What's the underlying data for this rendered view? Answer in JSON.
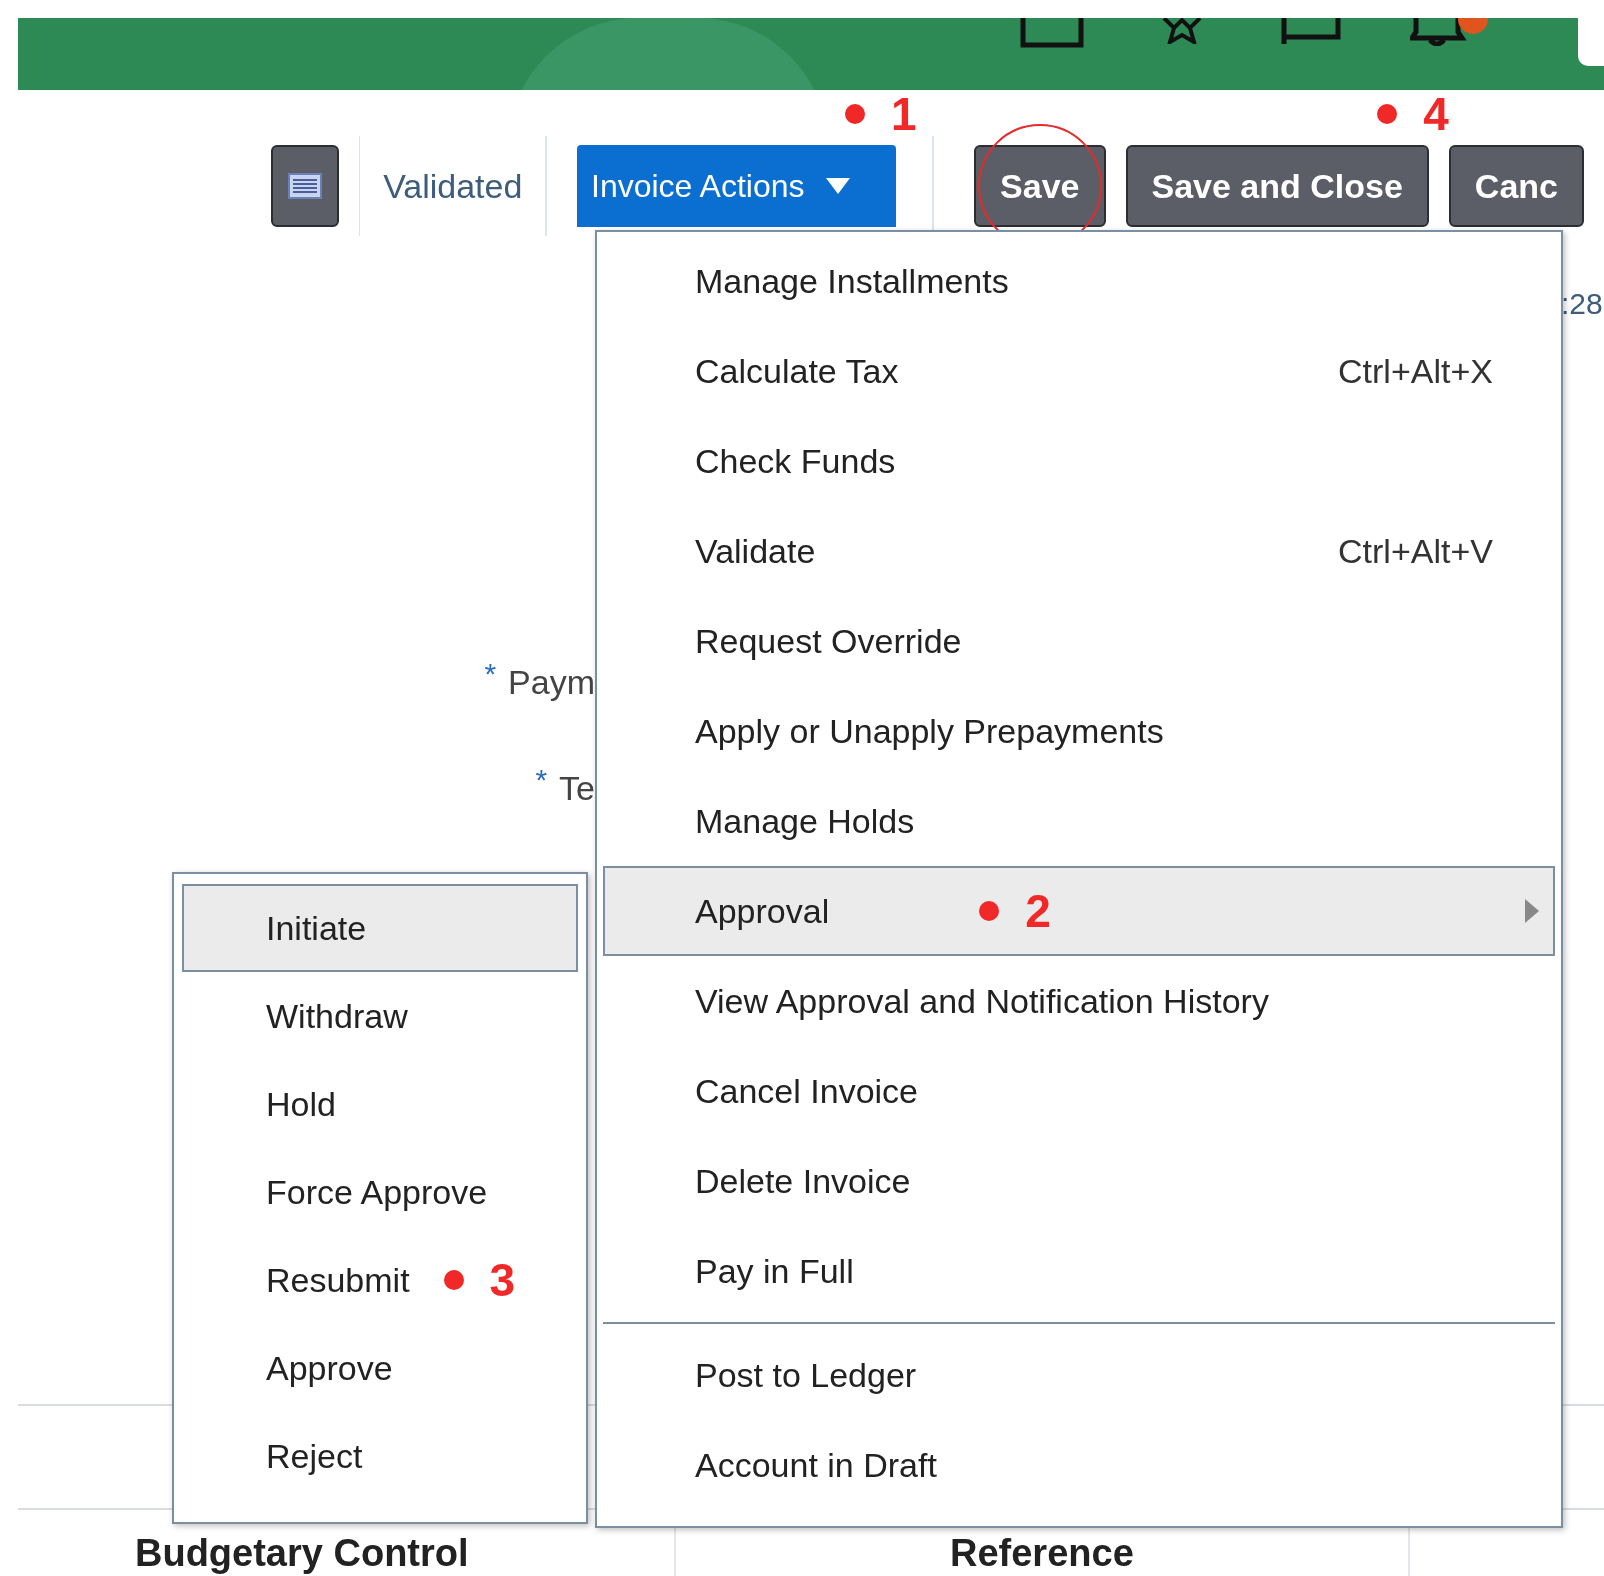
{
  "toolbar": {
    "status": "Validated",
    "actions_menu": {
      "label": "Invoice Actions",
      "expanded": true,
      "annotation": "1"
    },
    "buttons": [
      {
        "label": "Save",
        "highlighted": true
      },
      {
        "label": "Save and Close",
        "annotation": "4"
      },
      {
        "label": "Canc"
      }
    ]
  },
  "background_form": {
    "fields": [
      {
        "label": "Paym",
        "required_mark": "*"
      },
      {
        "label": "Te",
        "required_mark": "*"
      }
    ],
    "side_text": ":28"
  },
  "invoice_actions_menu": {
    "sections": [
      {
        "items": [
          {
            "label": "Manage Installments",
            "selected": false
          },
          {
            "label": "Calculate Tax",
            "shortcut": "Ctrl+Alt+X",
            "selected": false
          },
          {
            "label": "Check Funds",
            "selected": false
          },
          {
            "label": "Validate",
            "shortcut": "Ctrl+Alt+V",
            "selected": false
          },
          {
            "label": "Request Override",
            "selected": false
          },
          {
            "label": "Apply or Unapply Prepayments",
            "selected": false
          },
          {
            "label": "Manage Holds",
            "selected": false
          },
          {
            "label": "Approval",
            "selected": true,
            "has_submenu": true,
            "annotation": "2"
          },
          {
            "label": "View Approval and Notification History",
            "selected": false
          },
          {
            "label": "Cancel Invoice",
            "selected": false
          },
          {
            "label": "Delete Invoice",
            "selected": false
          },
          {
            "label": "Pay in Full",
            "selected": false
          }
        ]
      },
      {
        "items": [
          {
            "label": "Post to Ledger",
            "selected": false
          },
          {
            "label": "Account in Draft",
            "selected": false
          }
        ]
      }
    ]
  },
  "approval_submenu": {
    "items": [
      {
        "label": "Initiate",
        "selected": true
      },
      {
        "label": "Withdraw",
        "selected": false
      },
      {
        "label": "Hold",
        "selected": false
      },
      {
        "label": "Force Approve",
        "selected": false
      },
      {
        "label": "Resubmit",
        "selected": false,
        "annotation": "3"
      },
      {
        "label": "Approve",
        "selected": false
      },
      {
        "label": "Reject",
        "selected": false
      }
    ]
  },
  "sections": [
    {
      "title": "Budgetary Control"
    },
    {
      "title": "Reference"
    }
  ]
}
